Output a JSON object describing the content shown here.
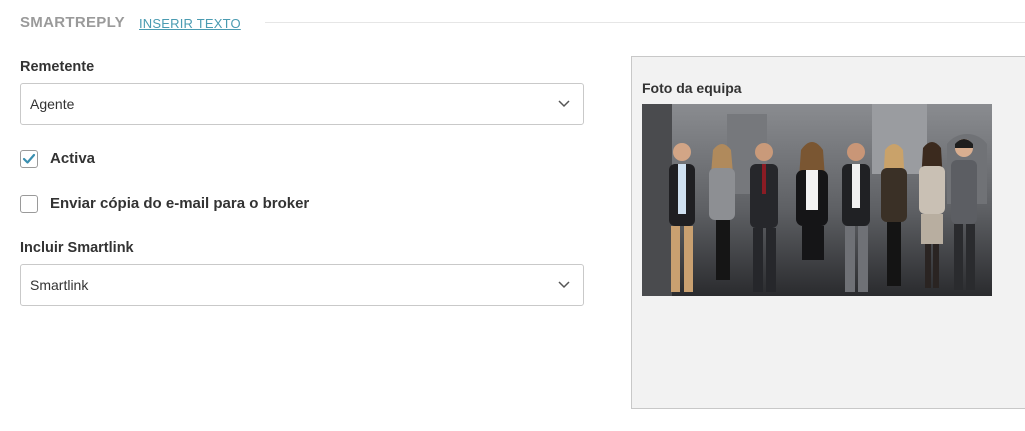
{
  "header": {
    "title": "SMARTREPLY",
    "link": "INSERIR TEXTO"
  },
  "sender": {
    "label": "Remetente",
    "value": "Agente"
  },
  "active_checkbox": {
    "label": "Activa",
    "checked": true
  },
  "copy_checkbox": {
    "label": "Enviar cópia do e-mail para o broker",
    "checked": false
  },
  "smartlink": {
    "label": "Incluir Smartlink",
    "value": "Smartlink"
  },
  "preview": {
    "title": "Foto da equipa",
    "image": "team-photo"
  },
  "colors": {
    "accent": "#4a9bb1",
    "check": "#3a8fb0",
    "border": "#c9c9c9",
    "panel_bg": "#f2f2f2"
  }
}
